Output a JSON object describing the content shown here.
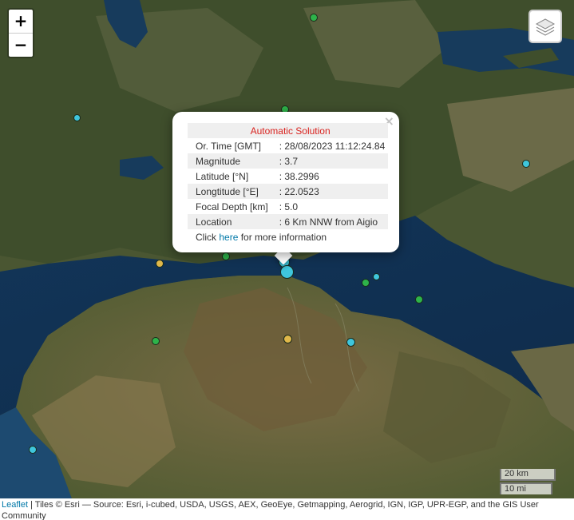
{
  "map": {
    "zoom_in_label": "+",
    "zoom_out_label": "−",
    "layers_icon": "layers-icon"
  },
  "popup": {
    "close_label": "×",
    "title": "Automatic Solution",
    "rows": [
      {
        "label": "Or. Time [GMT]",
        "value": ": 28/08/2023 11:12:24.84"
      },
      {
        "label": "Magnitude",
        "value": ": 3.7"
      },
      {
        "label": "Latitude [°N]",
        "value": ": 38.2996"
      },
      {
        "label": "Longtitude [°E]",
        "value": ": 22.0523"
      },
      {
        "label": "Focal Depth [km]",
        "value": ": 5.0"
      },
      {
        "label": "Location",
        "value": ": 6 Km NNW from Aigio"
      }
    ],
    "footer_prefix": "Click ",
    "footer_link": "here",
    "footer_suffix": " for more information"
  },
  "markers": [
    {
      "color": "#2eb34a"
    },
    {
      "color": "#2eb34a"
    },
    {
      "color": "#2eb34a"
    },
    {
      "color": "#2eb34a"
    },
    {
      "color": "#2eb34a"
    },
    {
      "color": "#2eb34a"
    },
    {
      "color": "#3fc6dc"
    },
    {
      "color": "#3fc6dc"
    },
    {
      "color": "#3fc6dc"
    },
    {
      "color": "#3fc6dc"
    },
    {
      "color": "#3fc6dc"
    },
    {
      "color": "#3fc6dc"
    },
    {
      "color": "#3fc6dc"
    },
    {
      "color": "#e0b84a"
    },
    {
      "color": "#e0b84a"
    }
  ],
  "scale": {
    "km_label": "20 km",
    "mi_label": "10 mi"
  },
  "attribution": {
    "leaflet_link": "Leaflet",
    "text": " | Tiles © Esri — Source: Esri, i-cubed, USDA, USGS, AEX, GeoEye, Getmapping, Aerogrid, IGN, IGP, UPR-EGP, and the GIS User Community"
  }
}
